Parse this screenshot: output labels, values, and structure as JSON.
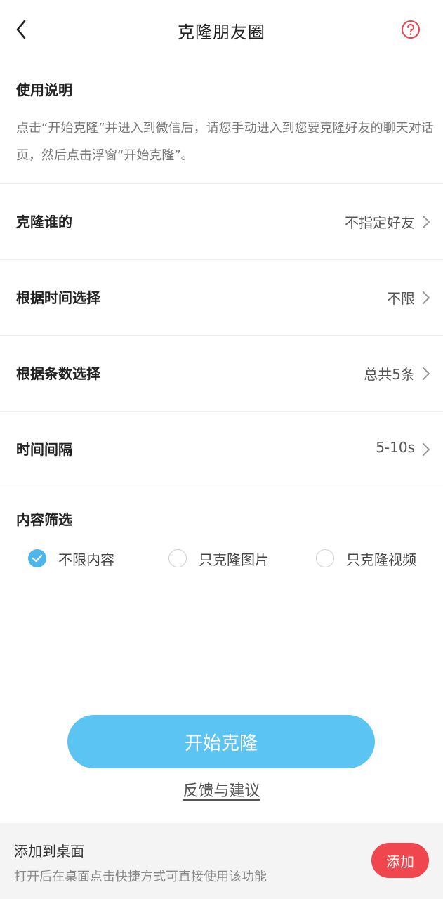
{
  "header": {
    "back_icon": "chevron-left-icon",
    "title": "克隆朋友圈",
    "help_icon": "question-circle-icon",
    "help_color": "#e8474f"
  },
  "instructions": {
    "heading": "使用说明",
    "text": "点击“开始克隆”并进入到微信后，请您手动进入到您要克隆好友的聊天对话页，然后点击浮窗“开始克隆”。"
  },
  "settings": [
    {
      "label": "克隆谁的",
      "value": "不指定好友"
    },
    {
      "label": "根据时间选择",
      "value": "不限"
    },
    {
      "label": "根据条数选择",
      "value": "总共5条"
    },
    {
      "label": "时间间隔",
      "value": "5-10s"
    }
  ],
  "content_filter": {
    "heading": "内容筛选",
    "options": [
      {
        "label": "不限内容",
        "checked": true
      },
      {
        "label": "只克隆图片",
        "checked": false
      },
      {
        "label": "只克隆视频",
        "checked": false
      }
    ],
    "accent": "#4db6ec"
  },
  "actions": {
    "start_label": "开始克隆",
    "start_color": "#5cc4f3",
    "feedback_label": "反馈与建议"
  },
  "bottom_bar": {
    "title": "添加到桌面",
    "description": "打开后在桌面点击快捷方式可直接使用该功能",
    "add_label": "添加",
    "add_color": "#f0464d"
  }
}
